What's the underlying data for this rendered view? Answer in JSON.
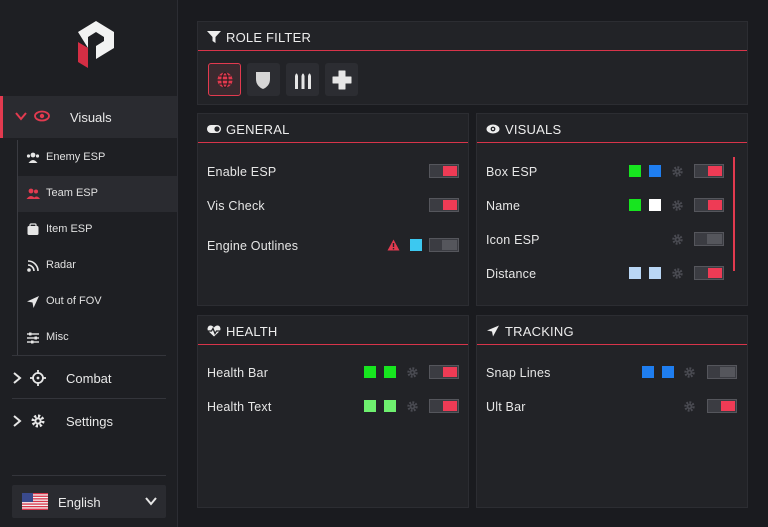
{
  "sidebar": {
    "visuals_label": "Visuals",
    "sub_items": [
      {
        "label": "Enemy ESP",
        "icon": "users-icon"
      },
      {
        "label": "Team ESP",
        "icon": "users-icon"
      },
      {
        "label": "Item ESP",
        "icon": "box-icon"
      },
      {
        "label": "Radar",
        "icon": "radar-icon"
      },
      {
        "label": "Out of FOV",
        "icon": "arrow-icon"
      },
      {
        "label": "Misc",
        "icon": "sliders-icon"
      }
    ],
    "combat_label": "Combat",
    "settings_label": "Settings",
    "language": "English"
  },
  "role_filter": {
    "title": "ROLE FILTER",
    "buttons": [
      "globe-icon",
      "shield-icon",
      "ammo-icon",
      "cross-icon"
    ]
  },
  "general": {
    "title": "GENERAL",
    "rows": [
      {
        "label": "Enable ESP",
        "toggle": "on"
      },
      {
        "label": "Vis Check",
        "toggle": "on"
      },
      {
        "label": "Engine Outlines",
        "toggle": "off"
      }
    ]
  },
  "visuals": {
    "title": "VISUALS",
    "rows": [
      {
        "label": "Box ESP",
        "toggle": "on"
      },
      {
        "label": "Name",
        "toggle": "on"
      },
      {
        "label": "Icon ESP",
        "toggle": "off"
      },
      {
        "label": "Distance",
        "toggle": "on"
      }
    ]
  },
  "health": {
    "title": "HEALTH",
    "rows": [
      {
        "label": "Health Bar",
        "toggle": "on"
      },
      {
        "label": "Health Text",
        "toggle": "on"
      }
    ]
  },
  "tracking": {
    "title": "TRACKING",
    "rows": [
      {
        "label": "Snap Lines",
        "toggle": "off"
      },
      {
        "label": "Ult Bar",
        "toggle": "on"
      }
    ]
  },
  "colors": {
    "accent": "#e23a4f",
    "toggle_on": "#ee3b55",
    "green": "#17e51f",
    "light_green": "#6ef06f",
    "blue": "#1f7ef0",
    "cyan": "#3cc8f0",
    "white": "#ffffff",
    "light_blue": "#b9d6f5"
  }
}
